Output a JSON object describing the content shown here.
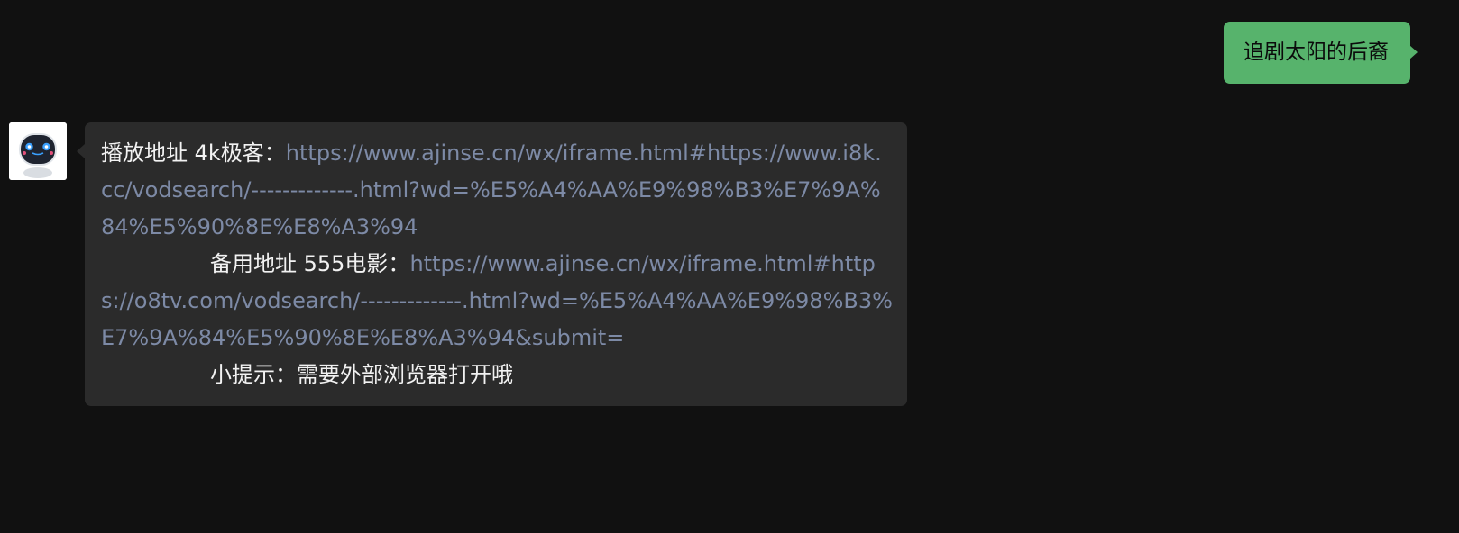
{
  "outgoing": {
    "text": "追剧太阳的后裔"
  },
  "incoming": {
    "line1_label": "播放地址 4k极客：",
    "line1_url": "https://www.ajinse.cn/wx/iframe.html#https://www.i8k.cc/vodsearch/-------------.html?wd=%E5%A4%AA%E9%98%B3%E7%9A%84%E5%90%8E%E8%A3%94",
    "line2_label": "备用地址 555电影：",
    "line2_url": "https://www.ajinse.cn/wx/iframe.html#https://o8tv.com/vodsearch/-------------.html?wd=%E5%A4%AA%E9%98%B3%E7%9A%84%E5%90%8E%E8%A3%94&submit=",
    "tip": "小提示：需要外部浏览器打开哦"
  },
  "colors": {
    "background": "#111111",
    "outgoing_bubble": "#57b36c",
    "incoming_bubble": "#2b2b2b",
    "link": "#7d8aa6"
  },
  "icons": {
    "avatar": "robot-avatar-icon"
  }
}
